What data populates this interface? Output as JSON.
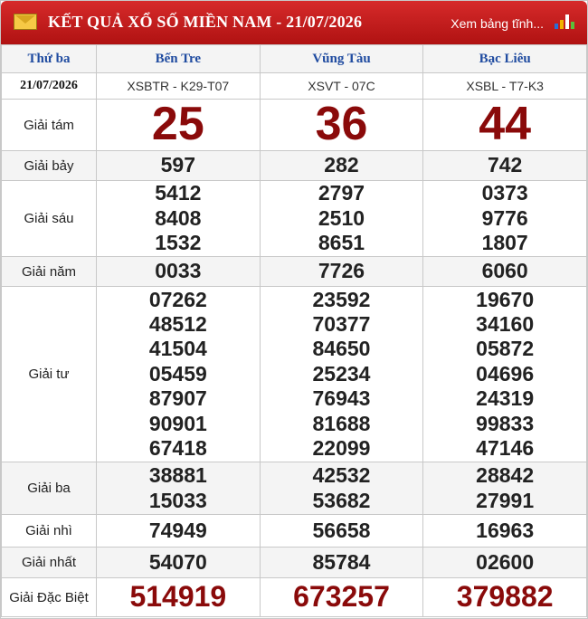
{
  "header": {
    "title": "KẾT QUẢ XỔ SỐ MIỀN NAM - 21/07/2026",
    "link": "Xem bảng tĩnh..."
  },
  "table": {
    "day": "Thứ ba",
    "date": "21/07/2026",
    "stations": [
      {
        "name": "Bến Tre",
        "code": "XSBTR - K29-T07"
      },
      {
        "name": "Vũng Tàu",
        "code": "XSVT - 07C"
      },
      {
        "name": "Bạc Liêu",
        "code": "XSBL - T7-K3"
      }
    ],
    "prizes": [
      {
        "label": "Giải tám",
        "results": [
          [
            "25"
          ],
          [
            "36"
          ],
          [
            "44"
          ]
        ]
      },
      {
        "label": "Giải bảy",
        "results": [
          [
            "597"
          ],
          [
            "282"
          ],
          [
            "742"
          ]
        ]
      },
      {
        "label": "Giải sáu",
        "results": [
          [
            "5412",
            "8408",
            "1532"
          ],
          [
            "2797",
            "2510",
            "8651"
          ],
          [
            "0373",
            "9776",
            "1807"
          ]
        ]
      },
      {
        "label": "Giải năm",
        "results": [
          [
            "0033"
          ],
          [
            "7726"
          ],
          [
            "6060"
          ]
        ]
      },
      {
        "label": "Giải tư",
        "results": [
          [
            "07262",
            "48512",
            "41504",
            "05459",
            "87907",
            "90901",
            "67418"
          ],
          [
            "23592",
            "70377",
            "84650",
            "25234",
            "76943",
            "81688",
            "22099"
          ],
          [
            "19670",
            "34160",
            "05872",
            "04696",
            "24319",
            "99833",
            "47146"
          ]
        ]
      },
      {
        "label": "Giải ba",
        "results": [
          [
            "38881",
            "15033"
          ],
          [
            "42532",
            "53682"
          ],
          [
            "28842",
            "27991"
          ]
        ]
      },
      {
        "label": "Giải nhì",
        "results": [
          [
            "74949"
          ],
          [
            "56658"
          ],
          [
            "16963"
          ]
        ]
      },
      {
        "label": "Giải nhất",
        "results": [
          [
            "54070"
          ],
          [
            "85784"
          ],
          [
            "02600"
          ]
        ]
      },
      {
        "label": "Giải Đặc Biệt",
        "results": [
          [
            "514919"
          ],
          [
            "673257"
          ],
          [
            "379882"
          ]
        ]
      }
    ]
  },
  "colors": {
    "header_red": "#c41a1a",
    "station_blue": "#1f4ba0",
    "prize_red": "#8a0a0a"
  }
}
